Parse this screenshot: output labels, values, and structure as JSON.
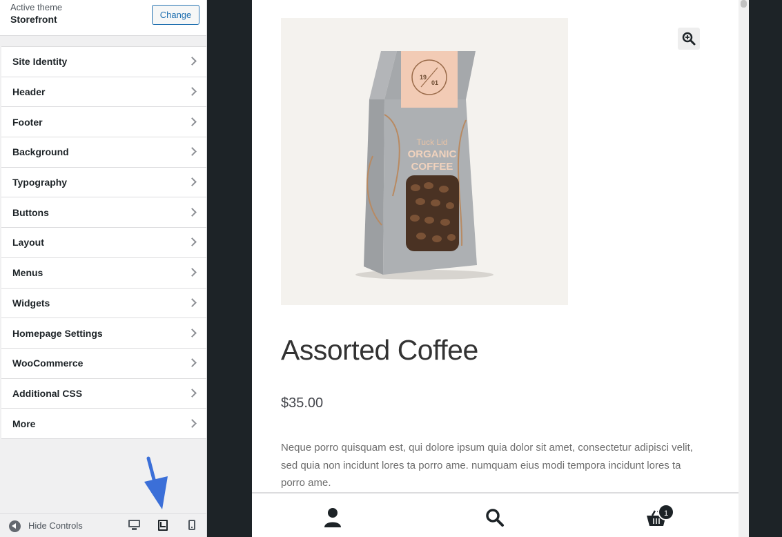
{
  "theme": {
    "label": "Active theme",
    "name": "Storefront",
    "change_label": "Change"
  },
  "menu": [
    {
      "label": "Site Identity"
    },
    {
      "label": "Header"
    },
    {
      "label": "Footer"
    },
    {
      "label": "Background"
    },
    {
      "label": "Typography"
    },
    {
      "label": "Buttons"
    },
    {
      "label": "Layout"
    },
    {
      "label": "Menus"
    },
    {
      "label": "Widgets"
    },
    {
      "label": "Homepage Settings"
    },
    {
      "label": "WooCommerce"
    },
    {
      "label": "Additional CSS"
    },
    {
      "label": "More"
    }
  ],
  "footer": {
    "hide_controls_label": "Hide Controls",
    "devices": [
      "desktop-icon",
      "tablet-icon",
      "mobile-icon"
    ],
    "active_device": "tablet"
  },
  "product": {
    "image_text": {
      "line1": "Tuck Lid",
      "line2": "ORGANIC",
      "line3": "COFFEE",
      "badge_top": "19",
      "badge_bottom": "01"
    },
    "title": "Assorted Coffee",
    "price": "$35.00",
    "description": "Neque porro quisquam est, qui dolore ipsum quia dolor sit amet, consectetur adipisci velit, sed quia non incidunt lores ta porro ame. numquam eius modi tempora incidunt lores ta porro ame."
  },
  "handheld_bar": {
    "cart_count": "1"
  },
  "colors": {
    "accent": "#2271b1",
    "annotation_arrow": "#3b6fd8",
    "preview_frame": "#1d2327"
  }
}
